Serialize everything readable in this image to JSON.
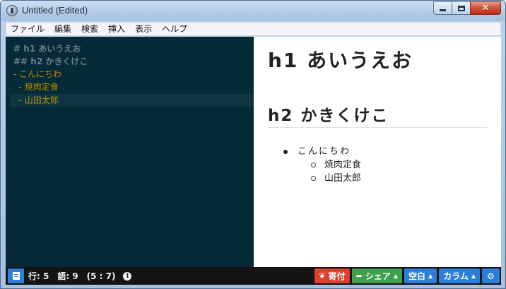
{
  "window": {
    "title": "Untitled (Edited)",
    "controls": {
      "minimize": "",
      "maximize": "",
      "close": "✕"
    }
  },
  "menu": {
    "items": [
      "ファイル",
      "編集",
      "検索",
      "挿入",
      "表示",
      "ヘルプ"
    ]
  },
  "editor": {
    "lines": [
      "# h1 あいうえお",
      "## h2 かきくけこ",
      "- こんにちわ",
      "  - 焼肉定食",
      "  - 山田太郎"
    ]
  },
  "preview": {
    "h1": "h1 あいうえお",
    "h2": "h2 かきくけこ",
    "list_item": "こんにちわ",
    "sub_items": [
      "焼肉定食",
      "山田太郎"
    ]
  },
  "statusbar": {
    "lines_label": "行: 5",
    "words_label": "語: 9",
    "position": "(5 : 7)",
    "donate_label": "寄付",
    "share_label": "シェア",
    "blank_label": "空白",
    "column_label": "カラム"
  },
  "colors": {
    "editor_bg": "#062a37",
    "heading_text": "#657f89",
    "list_text": "#b99000",
    "accent_blue": "#2c7fd8",
    "donate_red": "#d9402e",
    "share_green": "#3ea04e"
  },
  "icons": {
    "app": "app-icon",
    "document": "document-icon",
    "info": "info-icon",
    "donate": "leaf-icon",
    "share": "share-arrow-icon",
    "settings": "gear-icon"
  }
}
